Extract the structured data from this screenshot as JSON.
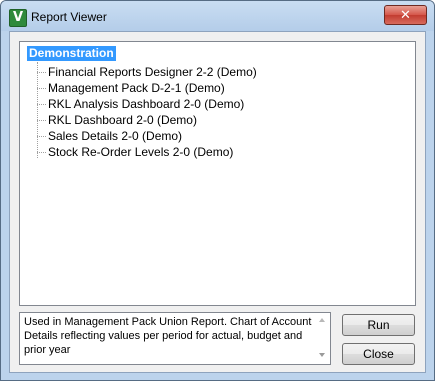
{
  "window": {
    "title": "Report Viewer",
    "app_icon_letter": "V",
    "close_glyph": "✕"
  },
  "tree": {
    "root_label": "Demonstration",
    "items": [
      {
        "label": "Financial Reports Designer 2-2 (Demo)"
      },
      {
        "label": "Management Pack D-2-1 (Demo)"
      },
      {
        "label": "RKL Analysis Dashboard 2-0 (Demo)"
      },
      {
        "label": "RKL Dashboard 2-0 (Demo)"
      },
      {
        "label": "Sales Details 2-0 (Demo)"
      },
      {
        "label": "Stock Re-Order Levels 2-0 (Demo)"
      }
    ]
  },
  "description": {
    "text": "Used in Management Pack Union Report. Chart of Account Details reflecting values per period for actual, budget and prior year"
  },
  "buttons": {
    "run_label": "Run",
    "close_label": "Close"
  },
  "colors": {
    "selection": "#3399ff",
    "titlebar": "#bcd3ec",
    "close_button": "#c94a3e"
  }
}
